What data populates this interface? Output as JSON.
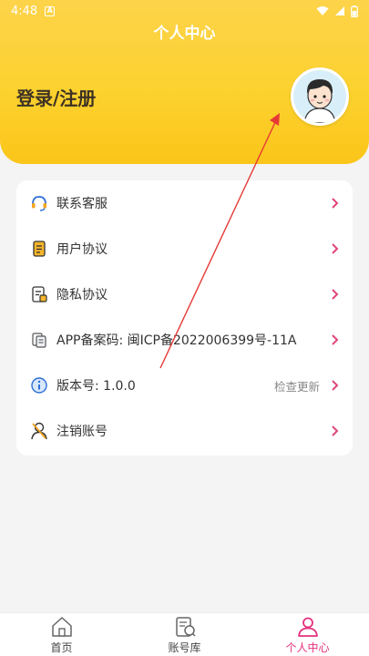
{
  "status": {
    "time": "4:48",
    "notif": "A"
  },
  "header": {
    "title": "个人中心",
    "login": "登录/注册"
  },
  "menu": [
    {
      "label": "联系客服",
      "icon": "headset-icon"
    },
    {
      "label": "用户协议",
      "icon": "document-icon"
    },
    {
      "label": "隐私协议",
      "icon": "privacy-document-icon"
    },
    {
      "label": "APP备案码: 闽ICP备2022006399号-11A",
      "icon": "copy-icon"
    },
    {
      "label": "版本号: 1.0.0",
      "icon": "info-icon",
      "extra": "检查更新"
    },
    {
      "label": "注销账号",
      "icon": "user-cancel-icon"
    }
  ],
  "tabs": [
    {
      "label": "首页",
      "icon": "home-icon"
    },
    {
      "label": "账号库",
      "icon": "account-library-icon"
    },
    {
      "label": "个人中心",
      "icon": "person-icon"
    }
  ],
  "colors": {
    "accent": "#e4317d",
    "header": "#fcd22f",
    "chevron": "#e0457a"
  }
}
